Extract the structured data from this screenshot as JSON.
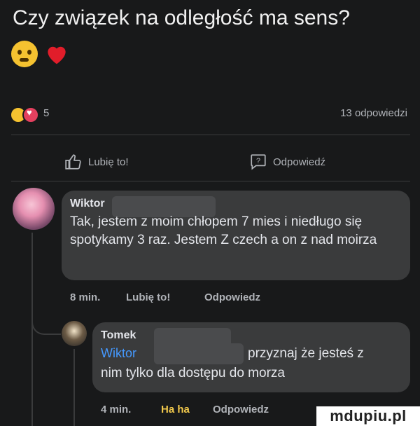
{
  "post": {
    "text": "Czy związek na odległość ma sens?",
    "emojis": [
      "sweat-smile-icon",
      "red-heart-icon"
    ]
  },
  "stats": {
    "reaction_count": "5",
    "comment_count": "13 odpowiedzi"
  },
  "actions": {
    "like_label": "Lubię to!",
    "comment_label": "Odpowiedź"
  },
  "comments": [
    {
      "author": "Wiktor",
      "text": "Tak, jestem z moim chłopem 7 mies i niedługo się spotykamy 3 raz. Jestem Z czech a on z nad moirza",
      "time": "8 min.",
      "like": "Lubię to!",
      "reply": "Odpowiedz"
    },
    {
      "author": "Tomek",
      "mention": "Wiktor",
      "text_line1": "przyznaj że jesteś z",
      "text_line2": "nim tylko dla dostępu do morza",
      "time": "4 min.",
      "reaction": "Ha ha",
      "reply": "Odpowiedz"
    }
  ],
  "watermark": "mdupiu.pl",
  "colors": {
    "background": "#18191a",
    "bubble": "#3a3b3c",
    "mention": "#4599ff",
    "secondary_text": "#b0b3b8"
  }
}
